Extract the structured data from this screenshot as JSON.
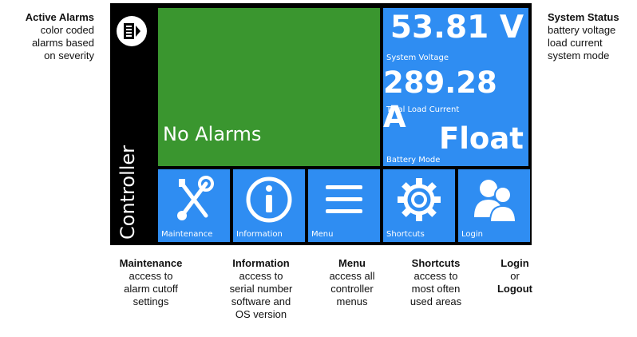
{
  "callouts": {
    "active_alarms": {
      "title": "Active Alarms",
      "lines": [
        "color coded",
        "alarms based",
        "on severity"
      ]
    },
    "system_status": {
      "title": "System Status",
      "lines": [
        "battery voltage",
        "load current",
        "system mode"
      ]
    },
    "maintenance": {
      "title": "Maintenance",
      "lines": [
        "access to",
        "alarm cutoff",
        "settings"
      ]
    },
    "information": {
      "title": "Information",
      "lines": [
        "access to",
        "serial number",
        "software and",
        "OS version"
      ]
    },
    "menu": {
      "title": "Menu",
      "lines": [
        "access all",
        "controller",
        "menus"
      ]
    },
    "shortcuts": {
      "title": "Shortcuts",
      "lines": [
        "access to",
        "most often",
        "used areas"
      ]
    },
    "login": {
      "title": "Login",
      "or": "or",
      "title2": "Logout"
    }
  },
  "screen": {
    "side_label": "Controller",
    "alarm_panel": {
      "text": "No Alarms",
      "color": "#3a962f"
    },
    "status": {
      "voltage": "53.81 V",
      "voltage_label": "System Voltage",
      "current": "289.28 A",
      "current_label": "Total Load Current",
      "mode": "Float",
      "mode_label": "Battery Mode",
      "color": "#2f8df2"
    },
    "tiles": {
      "maintenance": {
        "label": "Maintenance",
        "icon": "wrench-screwdriver-icon"
      },
      "information": {
        "label": "Information",
        "icon": "info-icon"
      },
      "menu": {
        "label": "Menu",
        "icon": "hamburger-menu-icon"
      },
      "shortcuts": {
        "label": "Shortcuts",
        "icon": "gear-icon"
      },
      "login": {
        "label": "Login",
        "icon": "users-icon"
      }
    }
  }
}
